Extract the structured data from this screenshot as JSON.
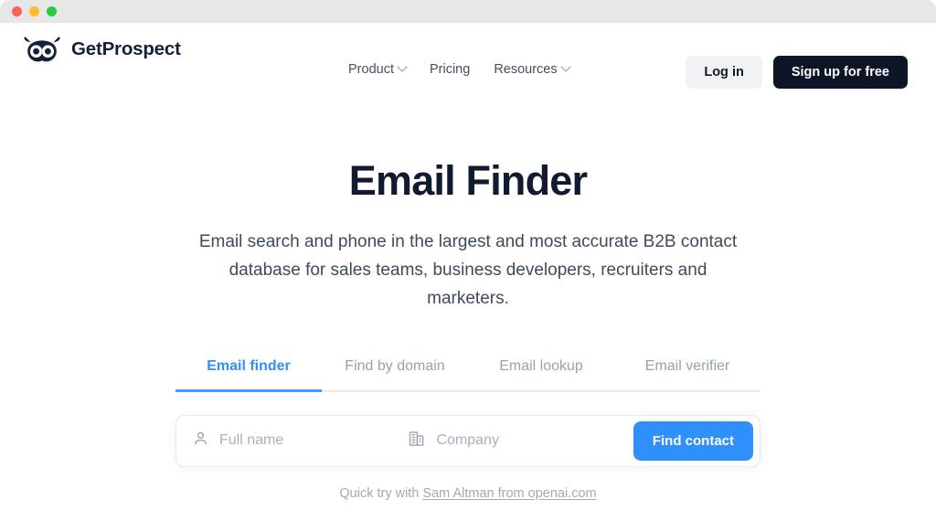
{
  "window": {
    "traffic_lights": [
      {
        "name": "close",
        "color": "#fb6158"
      },
      {
        "name": "minimize",
        "color": "#fcbd2d"
      },
      {
        "name": "maximize",
        "color": "#2bc940"
      }
    ]
  },
  "brand": {
    "name": "GetProspect",
    "logo_icon": "owl-icon"
  },
  "nav": {
    "items": [
      {
        "label": "Product",
        "has_dropdown": true
      },
      {
        "label": "Pricing",
        "has_dropdown": false
      },
      {
        "label": "Resources",
        "has_dropdown": true
      }
    ]
  },
  "header_actions": {
    "login_label": "Log in",
    "signup_label": "Sign up for free",
    "signup_bg": "#0d1526",
    "login_bg": "#f1f2f4"
  },
  "hero": {
    "title": "Email Finder",
    "subtitle": "Email search and phone in the largest and most accurate B2B contact database for sales teams, business developers, recruiters and marketers."
  },
  "tabs": {
    "active_index": 0,
    "active_color": "#2f8ffb",
    "items": [
      {
        "label": "Email finder"
      },
      {
        "label": "Find by domain"
      },
      {
        "label": "Email lookup"
      },
      {
        "label": "Email verifier"
      }
    ]
  },
  "search": {
    "name_placeholder": "Full name",
    "name_value": "",
    "name_icon": "person-icon",
    "company_placeholder": "Company",
    "company_value": "",
    "company_icon": "building-icon",
    "submit_label": "Find contact",
    "submit_color": "#2f8ffb"
  },
  "quick_try": {
    "prefix": "Quick try with ",
    "link_label": "Sam Altman from openai.com"
  }
}
